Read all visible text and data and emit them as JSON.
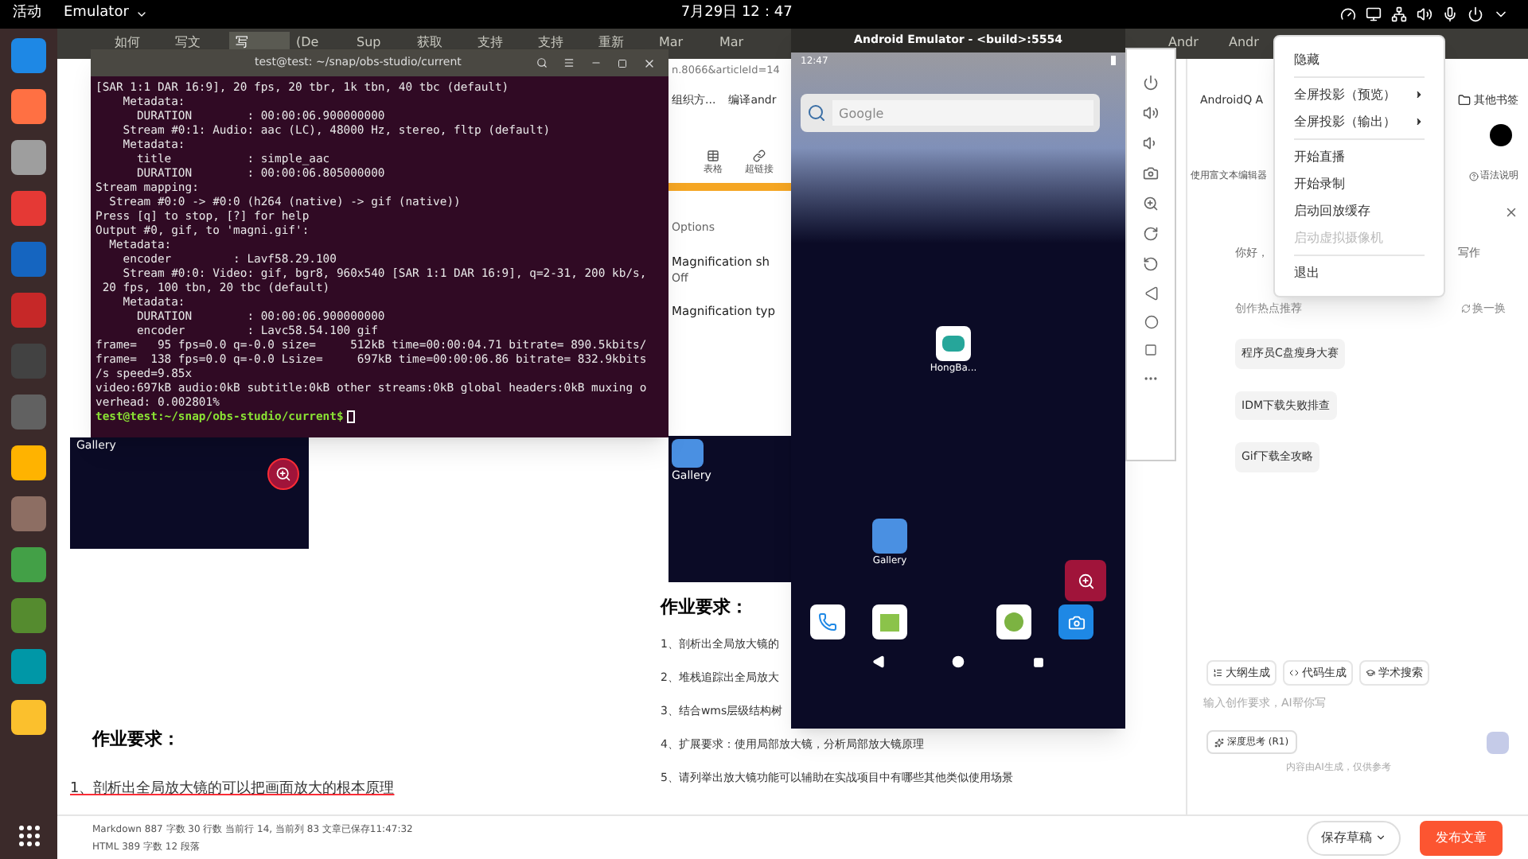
{
  "top_bar": {
    "activities": "活动",
    "app_name": "Emulator",
    "clock": "7月29日 12：47"
  },
  "browser": {
    "tabs": [
      {
        "label": "如何",
        "selected": false
      },
      {
        "label": "写文",
        "selected": false
      },
      {
        "label": "写",
        "selected": true
      },
      {
        "label": "(De",
        "selected": false
      },
      {
        "label": "Sup",
        "selected": false
      },
      {
        "label": "获取",
        "selected": false
      },
      {
        "label": "支持",
        "selected": false
      },
      {
        "label": "支持",
        "selected": false
      },
      {
        "label": "重新",
        "selected": false
      },
      {
        "label": "Mar",
        "selected": false
      },
      {
        "label": "Mar",
        "selected": false
      }
    ],
    "more_tabs": [
      {
        "label": "Andr",
        "selected": false
      },
      {
        "label": "Andr",
        "selected": false
      }
    ],
    "address": "n.8066&articleId=14",
    "bookmarks": [
      "组织方...",
      "编译andr"
    ],
    "more_bookmarks": [
      "AndroidQ A"
    ],
    "other_bookmarks": "其他书签",
    "preview_toolbar": [
      "表格",
      "超链接"
    ],
    "settings_shot": {
      "section": "Options",
      "rows": [
        {
          "title": "Magnification sh",
          "value": "Off"
        },
        {
          "title": "Magnification typ"
        }
      ]
    },
    "left_pane": {
      "shot_label": "Gallery",
      "heading": "作业要求：",
      "items": [
        "1、剖析出全局放大镜的可以把画面放大的根本原理"
      ]
    },
    "preview": {
      "shot_label": "Gallery",
      "heading": "作业要求：",
      "items": [
        "1、剖析出全局放大镜的",
        "2、堆栈追踪出全局放大",
        "3、结合wms层级结构树",
        "4、扩展要求：使用局部放大镜，分析局部放大镜原理",
        "5、请列举出放大镜功能可以辅助在实战项目中有哪些其他类似使用场景"
      ]
    },
    "right_toolbar": [
      "使用富文本编辑器",
      "语法说明"
    ],
    "assistant": {
      "greeting_start": "你好，",
      "greeting_end": "写作",
      "hot_title": "创作热点推荐",
      "refresh": "换一换",
      "topics": [
        "程序员C盘瘦身大赛",
        "IDM下载失败排查",
        "Gif下载全攻略"
      ],
      "actions": [
        "大纲生成",
        "代码生成",
        "学术搜索"
      ],
      "placeholder": "输入创作要求，AI帮你写",
      "deep_think": "深度思考 (R1)",
      "disclaimer": "内容由AI生成，仅供参考"
    },
    "footer": {
      "markdown_stats": "Markdown 887 字数 30 行数 当前行 14, 当前列 83 文章已保存11:47:32",
      "html_stats": "HTML 389 字数 12 段落",
      "save": "保存草稿",
      "publish": "发布文章"
    }
  },
  "terminal": {
    "title": "test@test: ~/snap/obs-studio/current",
    "lines": [
      "[SAR 1:1 DAR 16:9], 20 fps, 20 tbr, 1k tbn, 40 tbc (default)",
      "    Metadata:",
      "      DURATION        : 00:00:06.900000000",
      "    Stream #0:1: Audio: aac (LC), 48000 Hz, stereo, fltp (default)",
      "    Metadata:",
      "      title           : simple_aac",
      "      DURATION        : 00:00:06.805000000",
      "Stream mapping:",
      "  Stream #0:0 -> #0:0 (h264 (native) -> gif (native))",
      "Press [q] to stop, [?] for help",
      "Output #0, gif, to 'magni.gif':",
      "  Metadata:",
      "    encoder         : Lavf58.29.100",
      "    Stream #0:0: Video: gif, bgr8, 960x540 [SAR 1:1 DAR 16:9], q=2-31, 200 kb/s,",
      " 20 fps, 100 tbn, 20 tbc (default)",
      "    Metadata:",
      "      DURATION        : 00:00:06.900000000",
      "      encoder         : Lavc58.54.100 gif",
      "frame=   95 fps=0.0 q=-0.0 size=     512kB time=00:00:04.71 bitrate= 890.5kbits/",
      "frame=  138 fps=0.0 q=-0.0 Lsize=     697kB time=00:00:06.86 bitrate= 832.9kbits",
      "/s speed=9.85x",
      "video:697kB audio:0kB subtitle:0kB other streams:0kB global headers:0kB muxing o",
      "verhead: 0.002801%"
    ],
    "prompt": "test@test:~/snap/obs-studio/current$"
  },
  "emulator": {
    "title": "Android Emulator - <build>:5554",
    "status_time": "12:47",
    "search_placeholder": "Google",
    "apps": [
      "HongBa...",
      "Gallery"
    ]
  },
  "menu": {
    "groups": [
      [
        {
          "label": "隐藏",
          "submenu": false,
          "disabled": false
        }
      ],
      [
        {
          "label": "全屏投影（预览）",
          "submenu": true,
          "disabled": false
        },
        {
          "label": "全屏投影（输出）",
          "submenu": true,
          "disabled": false
        }
      ],
      [
        {
          "label": "开始直播",
          "submenu": false,
          "disabled": false
        },
        {
          "label": "开始录制",
          "submenu": false,
          "disabled": false
        },
        {
          "label": "启动回放缓存",
          "submenu": false,
          "disabled": false
        },
        {
          "label": "启动虚拟摄像机",
          "submenu": false,
          "disabled": true
        }
      ],
      [
        {
          "label": "退出",
          "submenu": false,
          "disabled": false
        }
      ]
    ]
  }
}
